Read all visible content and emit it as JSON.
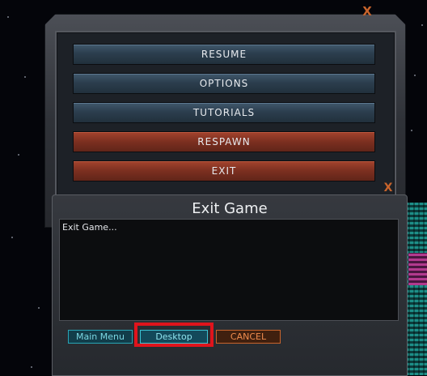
{
  "pause_menu": {
    "close_glyph": "X",
    "buttons": [
      {
        "label": "RESUME",
        "style": "blue"
      },
      {
        "label": "OPTIONS",
        "style": "blue"
      },
      {
        "label": "TUTORIALS",
        "style": "blue"
      },
      {
        "label": "RESPAWN",
        "style": "red"
      },
      {
        "label": "EXIT",
        "style": "red"
      }
    ]
  },
  "exit_dialog": {
    "title": "Exit Game",
    "message": "Exit Game...",
    "close_glyph": "X",
    "buttons": {
      "main_menu": "Main Menu",
      "desktop": "Desktop",
      "cancel": "CANCEL"
    }
  },
  "colors": {
    "accent_orange": "#c8642c",
    "accent_cyan": "#3bc2d3",
    "highlight_red": "#e0141c"
  }
}
